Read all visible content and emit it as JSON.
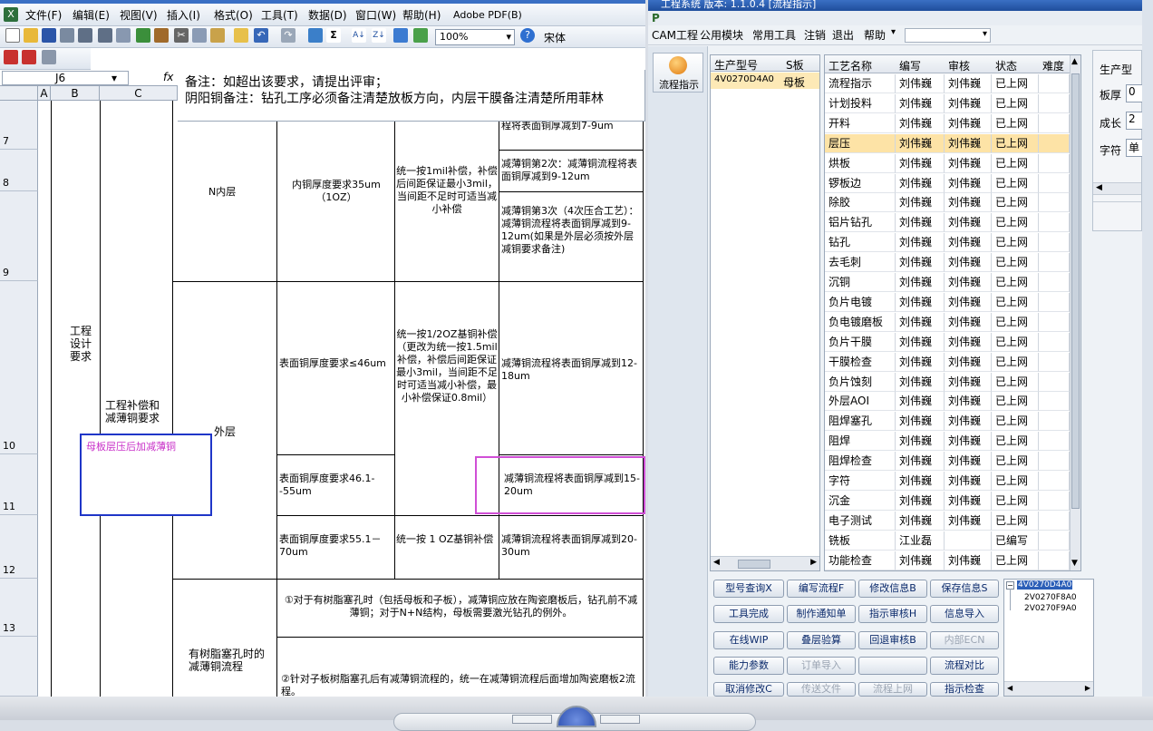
{
  "excel": {
    "menu": [
      "文件(F)",
      "编辑(E)",
      "视图(V)",
      "插入(I)",
      "格式(O)",
      "工具(T)",
      "数据(D)",
      "窗口(W)",
      "帮助(H)",
      "Adobe PDF(B)"
    ],
    "zoom": "100%",
    "font": "宋体",
    "name_box": "J6",
    "fx": "fx",
    "formula_lines": [
      "备注：如超出该要求，请提出评审；",
      "阴阳铜备注：钻孔工序必须备注清楚放板方向，内层干膜备注清楚所用菲林"
    ],
    "columns": [
      "A",
      "B",
      "C"
    ],
    "rows": [
      "7",
      "8",
      "9",
      "10",
      "11",
      "12",
      "13"
    ],
    "cells": {
      "r7_text": "程将表面铜厚减到7-9um",
      "r8_text": "减薄铜第2次：减薄铜流程将表面铜厚减到9-12um",
      "r9_text": "减薄铜第3次（4次压合工艺）：减薄铜流程将表面铜厚减到9-12um(如果是外层必须按外层减铜要求备注)",
      "n_layer": "N内层",
      "inner_cu": "内铜厚度要求35um（1OZ）",
      "comp_inner": "统一按1mil补偿，补偿后间距保证最小3mil，当间距不足时可适当减小补偿",
      "design_req": "工程设计要求",
      "comp_reduce": "工程补偿和减薄铜要求",
      "outer": "外层",
      "outer_r10": "表面铜厚度要求≤46um",
      "comp_outer": "统一按1/2OZ基铜补偿（更改为统一按1.5mil补偿，补偿后间距保证最小3mil，当间距不足时可适当减小补偿，最小补偿保证0.8mil）",
      "reduce_r10": "减薄铜流程将表面铜厚减到12-18um",
      "outer_r11": "表面铜厚度要求46.1--55um",
      "reduce_r11": "减薄铜流程将表面铜厚减到15-20um",
      "outer_r12": "表面铜厚度要求55.1－70um",
      "comp_r12": "统一按 1 OZ基铜补偿",
      "reduce_r12": "减薄铜流程将表面铜厚减到20-30um",
      "resin": "有树脂塞孔时的减薄铜流程",
      "r13_note": "①对于有树脂塞孔时（包括母板和子板），减薄铜应放在陶瓷磨板后，钻孔前不减薄铜；对于N+N结构，母板需要激光钻孔的例外。",
      "r14_note": "②针对子板树脂塞孔后有减薄铜流程的，统一在减薄铜流程后面增加陶瓷磨板2流程。",
      "annotation": "母板层压后加减薄铜"
    }
  },
  "cam": {
    "title": "工程系统  版本: 1.1.0.4  [流程指示]",
    "menu": [
      "CAM工程",
      "公用模块",
      "常用工具",
      "注销",
      "退出",
      "帮助"
    ],
    "side_button": "流程指示",
    "model_table": {
      "headers": [
        "生产型号",
        "S板"
      ],
      "rows": [
        [
          "4V0270D4A0",
          "母板"
        ]
      ]
    },
    "process_table": {
      "headers": [
        "工艺名称",
        "编写",
        "审核",
        "状态",
        "难度"
      ],
      "rows": [
        [
          "流程指示",
          "刘伟巍",
          "刘伟巍",
          "已上网"
        ],
        [
          "计划投料",
          "刘伟巍",
          "刘伟巍",
          "已上网"
        ],
        [
          "开料",
          "刘伟巍",
          "刘伟巍",
          "已上网"
        ],
        [
          "层压",
          "刘伟巍",
          "刘伟巍",
          "已上网"
        ],
        [
          "烘板",
          "刘伟巍",
          "刘伟巍",
          "已上网"
        ],
        [
          "锣板边",
          "刘伟巍",
          "刘伟巍",
          "已上网"
        ],
        [
          "除胶",
          "刘伟巍",
          "刘伟巍",
          "已上网"
        ],
        [
          "铝片钻孔",
          "刘伟巍",
          "刘伟巍",
          "已上网"
        ],
        [
          "钻孔",
          "刘伟巍",
          "刘伟巍",
          "已上网"
        ],
        [
          "去毛刺",
          "刘伟巍",
          "刘伟巍",
          "已上网"
        ],
        [
          "沉铜",
          "刘伟巍",
          "刘伟巍",
          "已上网"
        ],
        [
          "负片电镀",
          "刘伟巍",
          "刘伟巍",
          "已上网"
        ],
        [
          "负电镀磨板",
          "刘伟巍",
          "刘伟巍",
          "已上网"
        ],
        [
          "负片干膜",
          "刘伟巍",
          "刘伟巍",
          "已上网"
        ],
        [
          "干膜检查",
          "刘伟巍",
          "刘伟巍",
          "已上网"
        ],
        [
          "负片蚀刻",
          "刘伟巍",
          "刘伟巍",
          "已上网"
        ],
        [
          "外层AOI",
          "刘伟巍",
          "刘伟巍",
          "已上网"
        ],
        [
          "阻焊塞孔",
          "刘伟巍",
          "刘伟巍",
          "已上网"
        ],
        [
          "阻焊",
          "刘伟巍",
          "刘伟巍",
          "已上网"
        ],
        [
          "阻焊检查",
          "刘伟巍",
          "刘伟巍",
          "已上网"
        ],
        [
          "字符",
          "刘伟巍",
          "刘伟巍",
          "已上网"
        ],
        [
          "沉金",
          "刘伟巍",
          "刘伟巍",
          "已上网"
        ],
        [
          "电子测试",
          "刘伟巍",
          "刘伟巍",
          "已上网"
        ],
        [
          "铣板",
          "江业磊",
          "",
          "已编写"
        ],
        [
          "功能检查",
          "刘伟巍",
          "刘伟巍",
          "已上网"
        ]
      ],
      "selected_index": 3
    },
    "right_labels": [
      "生产型",
      "板厚",
      "成长",
      "字符"
    ],
    "right_values": [
      "0",
      "2",
      "单"
    ],
    "buttons": [
      [
        "型号查询X",
        "编写流程F",
        "修改信息B",
        "保存信息S"
      ],
      [
        "工具完成",
        "制作通知单",
        "指示审核H",
        "信息导入"
      ],
      [
        "在线WIP",
        "叠层验算",
        "回退审核B",
        "内部ECN"
      ],
      [
        "能力参数",
        "订单导入",
        "",
        "流程对比"
      ],
      [
        "取消修改C",
        "传送文件",
        "流程上网",
        "指示检查"
      ]
    ],
    "tree": [
      "4V0270D4A0",
      "2V0270F8A0",
      "2V0270F9A0"
    ]
  }
}
